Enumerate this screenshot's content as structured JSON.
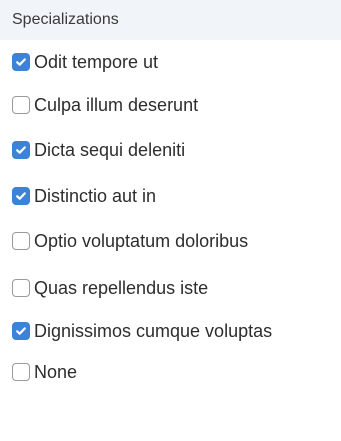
{
  "header": {
    "title": "Specializations"
  },
  "options": [
    {
      "label": "Odit tempore ut",
      "checked": true
    },
    {
      "label": "Culpa illum deserunt",
      "checked": false
    },
    {
      "label": "Dicta sequi deleniti",
      "checked": true
    },
    {
      "label": "Distinctio aut in",
      "checked": true
    },
    {
      "label": "Optio voluptatum doloribus",
      "checked": false
    },
    {
      "label": "Quas repellendus iste",
      "checked": false
    },
    {
      "label": "Dignissimos cumque voluptas",
      "checked": true
    },
    {
      "label": "None",
      "checked": false
    }
  ],
  "colors": {
    "header_background": "#f1f4f8",
    "checkbox_checked": "#3b83d9",
    "checkbox_unchecked_border": "#9a9a9a"
  },
  "icons": {
    "checked_mark": "checkmark-icon"
  }
}
